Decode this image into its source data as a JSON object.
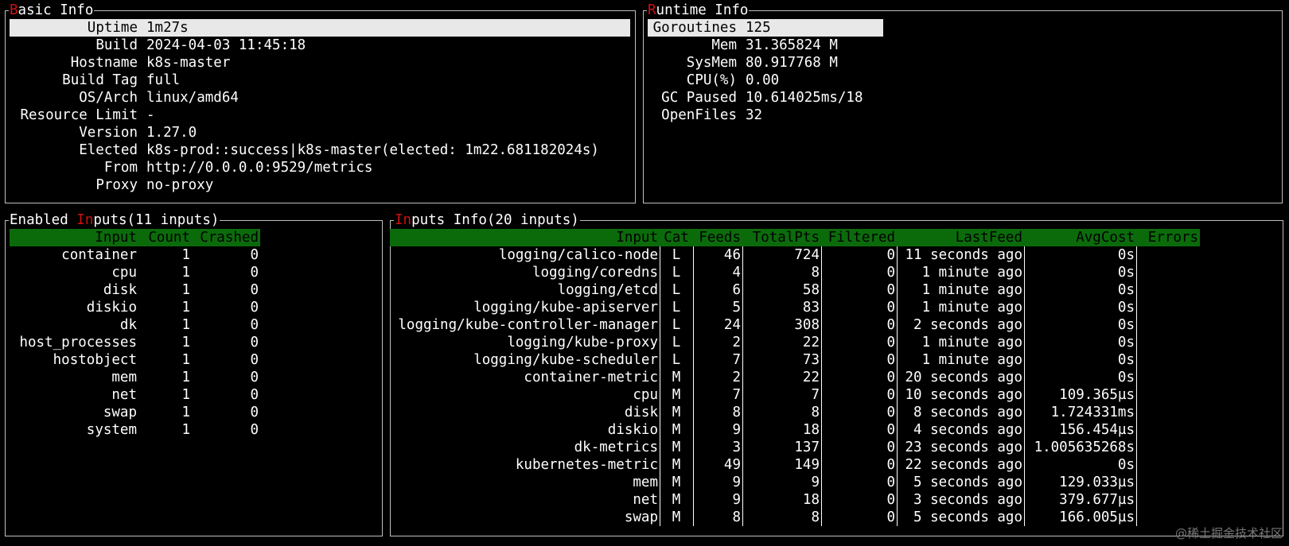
{
  "basic": {
    "title_hotkey": "B",
    "title_rest": "asic Info",
    "rows": [
      {
        "key": "Uptime",
        "value": "1m27s"
      },
      {
        "key": "Build",
        "value": "2024-04-03 11:45:18"
      },
      {
        "key": "Hostname",
        "value": "k8s-master"
      },
      {
        "key": "Build Tag",
        "value": "full"
      },
      {
        "key": "OS/Arch",
        "value": "linux/amd64"
      },
      {
        "key": "Resource Limit",
        "value": "-"
      },
      {
        "key": "Version",
        "value": "1.27.0"
      },
      {
        "key": "Elected",
        "value": "k8s-prod::success|k8s-master(elected: 1m22.681182024s)"
      },
      {
        "key": "From",
        "value": "http://0.0.0.0:9529/metrics"
      },
      {
        "key": "Proxy",
        "value": "no-proxy"
      }
    ]
  },
  "runtime": {
    "title_hotkey": "R",
    "title_rest": "untime Info",
    "rows": [
      {
        "key": "Goroutines",
        "value": "125"
      },
      {
        "key": "Mem",
        "value": "31.365824 M"
      },
      {
        "key": "SysMem",
        "value": "80.917768 M"
      },
      {
        "key": "CPU(%)",
        "value": "0.00"
      },
      {
        "key": "GC Paused",
        "value": "10.614025ms/18"
      },
      {
        "key": "OpenFiles",
        "value": "32"
      }
    ]
  },
  "enabled": {
    "title_pre": "Enabled ",
    "title_hotkey": "In",
    "title_rest": "puts(11 inputs)",
    "headers": [
      "Input",
      "Count",
      "Crashed"
    ],
    "rows": [
      [
        "container",
        "1",
        "0"
      ],
      [
        "cpu",
        "1",
        "0"
      ],
      [
        "disk",
        "1",
        "0"
      ],
      [
        "diskio",
        "1",
        "0"
      ],
      [
        "dk",
        "1",
        "0"
      ],
      [
        "host_processes",
        "1",
        "0"
      ],
      [
        "hostobject",
        "1",
        "0"
      ],
      [
        "mem",
        "1",
        "0"
      ],
      [
        "net",
        "1",
        "0"
      ],
      [
        "swap",
        "1",
        "0"
      ],
      [
        "system",
        "1",
        "0"
      ]
    ]
  },
  "inputs": {
    "title_hotkey": "In",
    "title_rest": "puts Info(20 inputs)",
    "headers": [
      "Input",
      "Cat",
      "Feeds",
      "TotalPts",
      "Filtered",
      "LastFeed",
      "AvgCost",
      "Errors"
    ],
    "rows": [
      [
        "logging/calico-node",
        "L",
        "46",
        "724",
        "0",
        "11 seconds ago",
        "0s",
        ""
      ],
      [
        "logging/coredns",
        "L",
        "4",
        "8",
        "0",
        "1 minute ago",
        "0s",
        ""
      ],
      [
        "logging/etcd",
        "L",
        "6",
        "58",
        "0",
        "1 minute ago",
        "0s",
        ""
      ],
      [
        "logging/kube-apiserver",
        "L",
        "5",
        "83",
        "0",
        "1 minute ago",
        "0s",
        ""
      ],
      [
        "logging/kube-controller-manager",
        "L",
        "24",
        "308",
        "0",
        "2 seconds ago",
        "0s",
        ""
      ],
      [
        "logging/kube-proxy",
        "L",
        "2",
        "22",
        "0",
        "1 minute ago",
        "0s",
        ""
      ],
      [
        "logging/kube-scheduler",
        "L",
        "7",
        "73",
        "0",
        "1 minute ago",
        "0s",
        ""
      ],
      [
        "container-metric",
        "M",
        "2",
        "22",
        "0",
        "20 seconds ago",
        "0s",
        ""
      ],
      [
        "cpu",
        "M",
        "7",
        "7",
        "0",
        "10 seconds ago",
        "109.365µs",
        ""
      ],
      [
        "disk",
        "M",
        "8",
        "8",
        "0",
        "8 seconds ago",
        "1.724331ms",
        ""
      ],
      [
        "diskio",
        "M",
        "9",
        "18",
        "0",
        "4 seconds ago",
        "156.454µs",
        ""
      ],
      [
        "dk-metrics",
        "M",
        "3",
        "137",
        "0",
        "23 seconds ago",
        "1.005635268s",
        ""
      ],
      [
        "kubernetes-metric",
        "M",
        "49",
        "149",
        "0",
        "22 seconds ago",
        "0s",
        ""
      ],
      [
        "mem",
        "M",
        "9",
        "9",
        "0",
        "5 seconds ago",
        "129.033µs",
        ""
      ],
      [
        "net",
        "M",
        "9",
        "18",
        "0",
        "3 seconds ago",
        "379.677µs",
        ""
      ],
      [
        "swap",
        "M",
        "8",
        "8",
        "0",
        "5 seconds ago",
        "166.005µs",
        ""
      ]
    ]
  },
  "watermark": "@稀土掘金技术社区",
  "colors": {
    "hotkey": "#cc1111",
    "header_bg": "#0b6b0b",
    "selected_bg": "#e8e8e8",
    "border": "#bfbfbf"
  }
}
